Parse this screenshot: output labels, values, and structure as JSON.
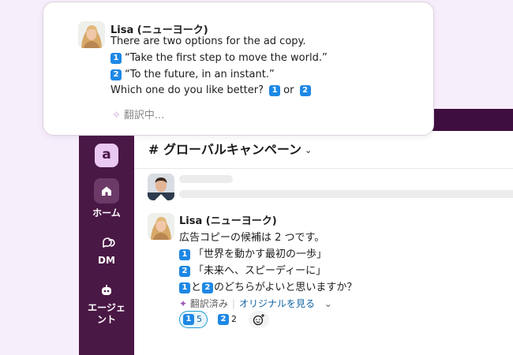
{
  "card": {
    "author": "Lisa (ニューヨーク)",
    "intro": "There are two options for the ad copy.",
    "option1_badge": "1",
    "option1": "“Take the first step to move the world.”",
    "option2_badge": "2",
    "option2": "“To the future, in an instant.”",
    "question_prefix": "Which one do you like better?",
    "question_or": "or",
    "status": "翻訳中..."
  },
  "app": {
    "workspace_initial": "a",
    "rail": {
      "home": "ホーム",
      "dm": "DM",
      "agents": "エージェント"
    },
    "channel": {
      "title": "# グローバルキャンペーン",
      "chevron": "⌄"
    },
    "message": {
      "author": "Lisa (ニューヨーク)",
      "intro": "広告コピーの候補は 2 つです。",
      "option1_badge": "1",
      "option1": "「世界を動かす最初の一歩」",
      "option2_badge": "2",
      "option2": "「未来へ、スピーディーに」",
      "question_badge1": "1",
      "question_mid": "と",
      "question_badge2": "2",
      "question_suffix": "のどちらがよいと思いますか？",
      "translated_label": "翻訳済み",
      "show_original": "オリジナルを見る",
      "reactions": [
        {
          "badge": "1",
          "count": "5",
          "selected": true
        },
        {
          "badge": "2",
          "count": "2",
          "selected": false
        }
      ]
    }
  },
  "colors": {
    "background": "#f7eefb",
    "sidebar": "#4a1845",
    "accent_badge": "#1e88e5",
    "link": "#1264a3"
  },
  "icons": {
    "workspace": "workspace-icon",
    "home": "home-icon",
    "dm": "dm-icon",
    "agent": "agent-icon",
    "sparkle": "sparkle-icon",
    "add_reaction": "add-reaction-icon"
  }
}
